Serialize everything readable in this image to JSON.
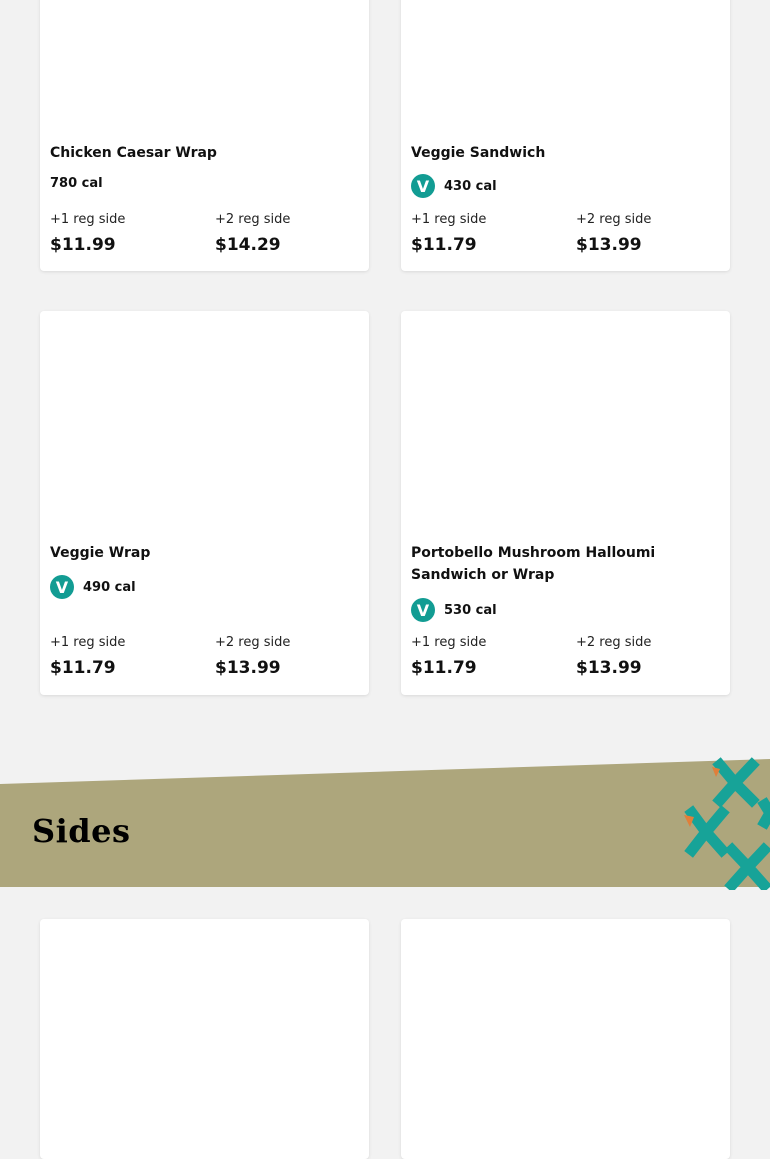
{
  "colors": {
    "background": "#f2f2f2",
    "card": "#ffffff",
    "banner": "#ada67c",
    "veg_badge": "#129c93",
    "pattern_teal": "#17a398",
    "pattern_orange": "#e07f3a"
  },
  "items": [
    {
      "name": "Chicken Caesar Wrap",
      "calories": "780 cal",
      "vegetarian": false,
      "options": [
        {
          "label": "+1 reg side",
          "price": "$11.99"
        },
        {
          "label": "+2 reg side",
          "price": "$14.29"
        }
      ]
    },
    {
      "name": "Veggie Sandwich",
      "calories": "430 cal",
      "vegetarian": true,
      "badge": "V",
      "options": [
        {
          "label": "+1 reg side",
          "price": "$11.79"
        },
        {
          "label": "+2 reg side",
          "price": "$13.99"
        }
      ]
    },
    {
      "name": "Veggie Wrap",
      "calories": "490 cal",
      "vegetarian": true,
      "badge": "V",
      "options": [
        {
          "label": "+1 reg side",
          "price": "$11.79"
        },
        {
          "label": "+2 reg side",
          "price": "$13.99"
        }
      ]
    },
    {
      "name": "Portobello Mushroom Halloumi Sandwich or Wrap",
      "calories": "530 cal",
      "vegetarian": true,
      "badge": "V",
      "options": [
        {
          "label": "+1 reg side",
          "price": "$11.79"
        },
        {
          "label": "+2 reg side",
          "price": "$13.99"
        }
      ]
    }
  ],
  "sides_section": {
    "title": "Sides",
    "decoration": "cross-pattern-icon"
  }
}
